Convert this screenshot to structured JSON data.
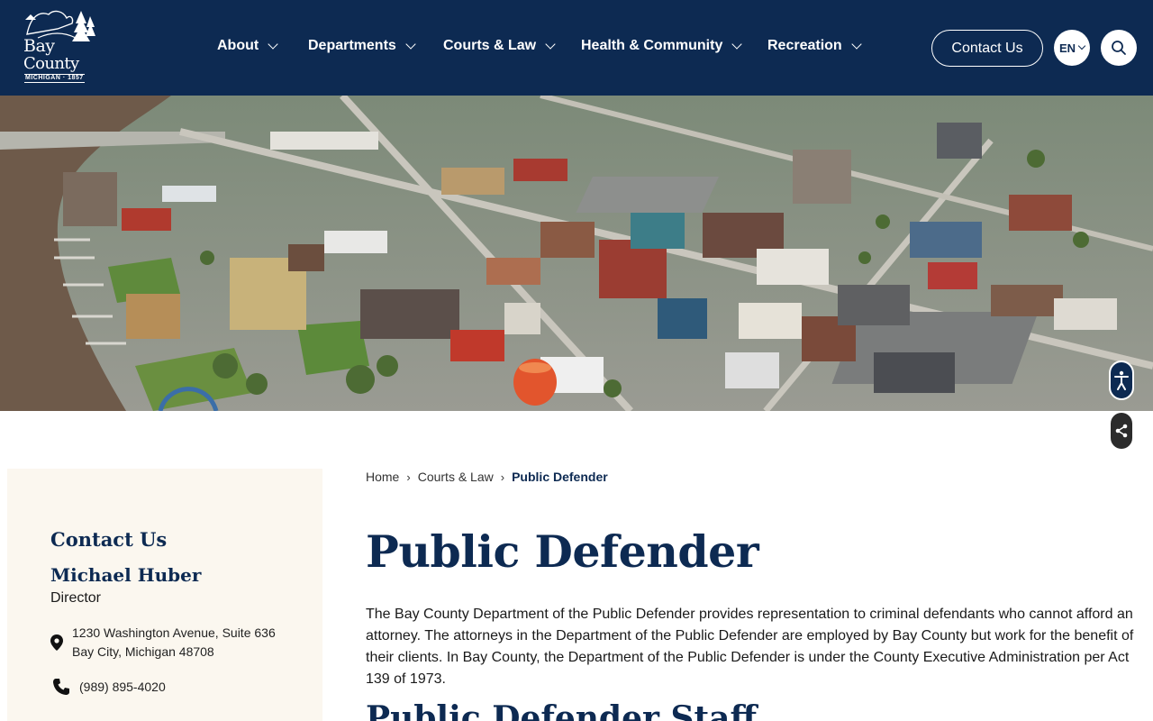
{
  "brand": {
    "logo_line1": "Bay",
    "logo_line2": "County",
    "logo_sub": "MICHIGAN · 1857"
  },
  "nav": {
    "items": [
      {
        "label": "About"
      },
      {
        "label": "Departments"
      },
      {
        "label": "Courts & Law"
      },
      {
        "label": "Health & Community"
      },
      {
        "label": "Recreation"
      }
    ],
    "contact_label": "Contact Us",
    "language": "EN"
  },
  "icons": {
    "search": "search-icon",
    "accessibility": "accessibility-icon",
    "share": "share-icon",
    "location": "location-pin-icon",
    "phone": "phone-icon"
  },
  "colors": {
    "primary": "#0d2a52",
    "sidebar_bg": "#fbf7ef"
  },
  "sidebar": {
    "heading": "Contact Us",
    "name": "Michael Huber",
    "role": "Director",
    "address_line1": "1230 Washington Avenue, Suite 636",
    "address_line2": "Bay City, Michigan 48708",
    "phone": "(989) 895-4020"
  },
  "breadcrumb": {
    "items": [
      "Home",
      "Courts & Law"
    ],
    "current": "Public Defender"
  },
  "main": {
    "title": "Public Defender",
    "intro": "The Bay County Department of the Public Defender provides representation to criminal defendants who cannot afford an attorney. The attorneys in the Department of the Public Defender are employed by Bay County but work for the benefit of their clients. In Bay County, the Department of the Public Defender is under the County Executive Administration per Act 139 of 1973.",
    "subtitle": "Public Defender Staff"
  }
}
